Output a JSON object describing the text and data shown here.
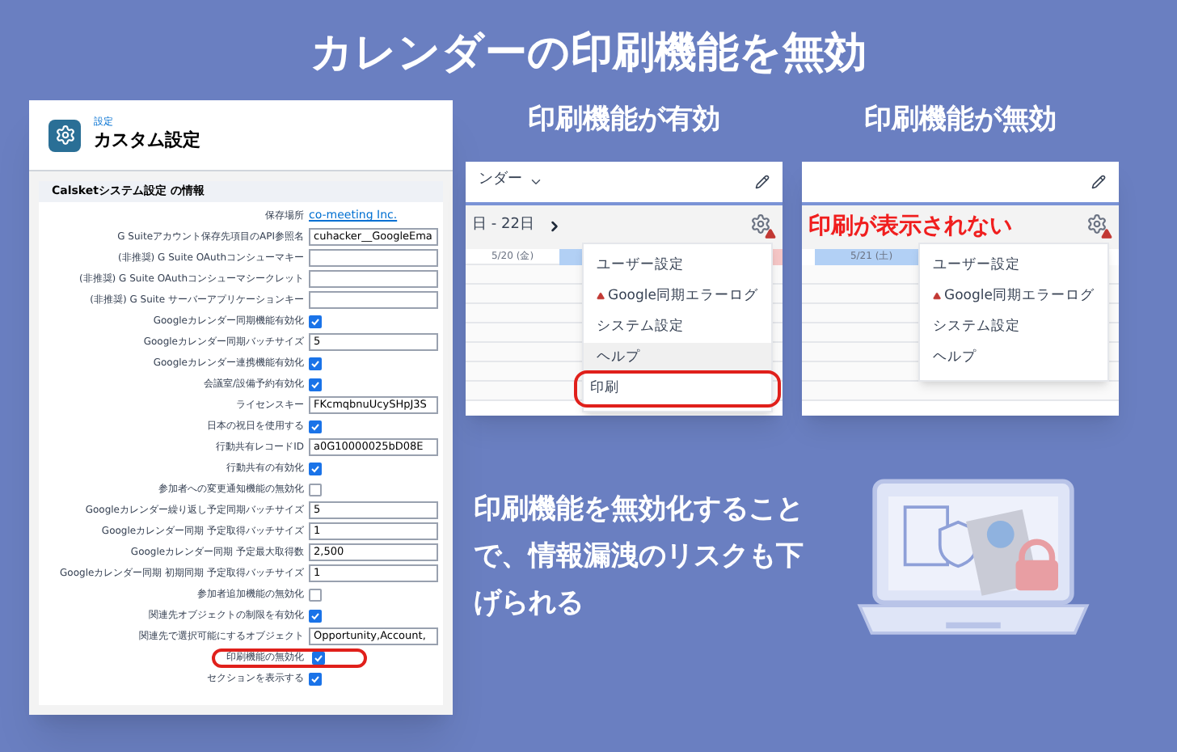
{
  "headline": "カレンダーの印刷機能を無効",
  "settings": {
    "breadcrumb": "設定",
    "title": "カスタム設定",
    "section": "Calsketシステム設定 の情報",
    "rows": [
      {
        "label": "保存場所",
        "kind": "link",
        "value": "co-meeting Inc."
      },
      {
        "label": "G Suiteアカウント保存先項目のAPI参照名",
        "kind": "text",
        "value": "cuhacker__GoogleEma"
      },
      {
        "label": "(非推奨) G Suite OAuthコンシューマキー",
        "kind": "text"
      },
      {
        "label": "(非推奨) G Suite OAuthコンシューマシークレット",
        "kind": "text"
      },
      {
        "label": "(非推奨) G Suite サーバーアプリケーションキー",
        "kind": "text"
      },
      {
        "label": "Googleカレンダー同期機能有効化",
        "kind": "checkbox",
        "checked": true
      },
      {
        "label": "Googleカレンダー同期バッチサイズ",
        "kind": "text",
        "value": "5"
      },
      {
        "label": "Googleカレンダー連携機能有効化",
        "kind": "checkbox",
        "checked": true
      },
      {
        "label": "会議室/設備予約有効化",
        "kind": "checkbox",
        "checked": true
      },
      {
        "label": "ライセンスキー",
        "kind": "text",
        "value": "FKcmqbnuUcySHpJ3S"
      },
      {
        "label": "日本の祝日を使用する",
        "kind": "checkbox",
        "checked": true
      },
      {
        "label": "行動共有レコードID",
        "kind": "text",
        "value": "a0G10000025bD08E"
      },
      {
        "label": "行動共有の有効化",
        "kind": "checkbox",
        "checked": true
      },
      {
        "label": "参加者への変更通知機能の無効化",
        "kind": "checkbox",
        "checked": false
      },
      {
        "label": "Googleカレンダー繰り返し予定同期バッチサイズ",
        "kind": "text",
        "value": "5"
      },
      {
        "label": "Googleカレンダー同期 予定取得バッチサイズ",
        "kind": "text",
        "value": "1"
      },
      {
        "label": "Googleカレンダー同期 予定最大取得数",
        "kind": "text",
        "value": "2,500"
      },
      {
        "label": "Googleカレンダー同期 初期同期 予定取得バッチサイズ",
        "kind": "text",
        "value": "1"
      },
      {
        "label": "参加者追加機能の無効化",
        "kind": "checkbox",
        "checked": false
      },
      {
        "label": "関連先オブジェクトの制限を有効化",
        "kind": "checkbox",
        "checked": true
      },
      {
        "label": "関連先で選択可能にするオブジェクト",
        "kind": "text",
        "value": "Opportunity,Account,"
      },
      {
        "label": "印刷機能の無効化",
        "kind": "checkbox",
        "checked": true,
        "highlighted": true
      },
      {
        "label": "セクションを表示する",
        "kind": "checkbox",
        "checked": true
      }
    ]
  },
  "panels": [
    {
      "caption": "印刷機能が有効",
      "view_menu": "ンダー",
      "date_range": "日 - 22日",
      "day_header": "5/20 (金)",
      "menu": [
        {
          "label": "ユーザー設定",
          "warning": false,
          "hovered": false,
          "highlighted": false
        },
        {
          "label": "Google同期エラーログ",
          "warning": true,
          "hovered": false,
          "highlighted": false
        },
        {
          "label": "システム設定",
          "warning": false,
          "hovered": false,
          "highlighted": false
        },
        {
          "label": "ヘルプ",
          "warning": false,
          "hovered": true,
          "highlighted": false
        },
        {
          "label": "印刷",
          "warning": false,
          "hovered": false,
          "highlighted": true
        }
      ]
    },
    {
      "caption": "印刷機能が無効",
      "annotation": "印刷が表示されない",
      "day_header": "5/21 (土)",
      "menu": [
        {
          "label": "ユーザー設定",
          "warning": false,
          "hovered": false,
          "highlighted": false
        },
        {
          "label": "Google同期エラーログ",
          "warning": true,
          "hovered": false,
          "highlighted": false
        },
        {
          "label": "システム設定",
          "warning": false,
          "hovered": false,
          "highlighted": false
        },
        {
          "label": "ヘルプ",
          "warning": false,
          "hovered": false,
          "highlighted": false
        }
      ]
    }
  ],
  "message": "印刷機能を無効化することで、情報漏洩のリスクも下げられる"
}
